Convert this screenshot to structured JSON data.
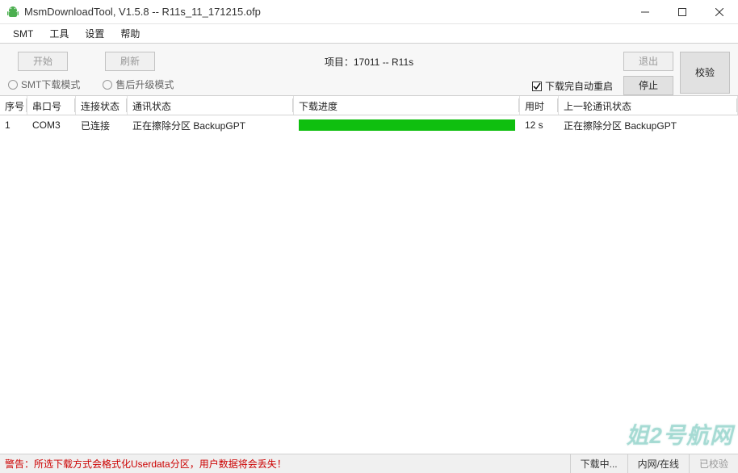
{
  "window": {
    "title": "MsmDownloadTool, V1.5.8 -- R11s_11_171215.ofp"
  },
  "menu": {
    "smt": "SMT",
    "tools": "工具",
    "settings": "设置",
    "help": "帮助"
  },
  "toolbar": {
    "start": "开始",
    "refresh": "刷新",
    "exit": "退出",
    "verify": "校验",
    "stop": "停止",
    "project_label": "项目：",
    "project_value": "17011 -- R11s"
  },
  "modes": {
    "smt_download": "SMT下载模式",
    "aftersale_upgrade": "售后升级模式"
  },
  "options": {
    "auto_restart_label": "下载完自动重启"
  },
  "table": {
    "headers": {
      "seq": "序号",
      "port": "串口号",
      "conn": "连接状态",
      "comm": "通讯状态",
      "progress": "下载进度",
      "time": "用时",
      "last": "上一轮通讯状态"
    },
    "row": {
      "seq": "1",
      "port": "COM3",
      "conn": "已连接",
      "comm": "正在擦除分区 BackupGPT",
      "time": "12 s",
      "last": "正在擦除分区 BackupGPT"
    }
  },
  "statusbar": {
    "warning": "警告：所选下载方式会格式化Userdata分区，用户数据将会丢失！",
    "downloading": "下载中...",
    "network": "内网/在线",
    "verify": "已校验"
  },
  "watermark": "姐2号航网"
}
